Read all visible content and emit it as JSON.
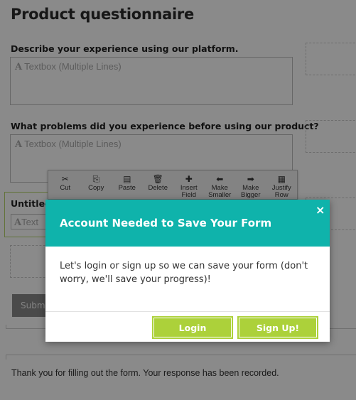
{
  "form": {
    "title": "Product questionnaire",
    "questions": [
      {
        "label": "Describe your experience using our platform.",
        "placeholder": "Textbox (Multiple Lines)"
      },
      {
        "label": "What problems did you experience before using our product?",
        "placeholder": "Textbox (Multiple Lines)"
      }
    ],
    "untitled_field": {
      "label": "Untitled",
      "placeholder": "Text"
    },
    "submit_label": "Submit",
    "thank_you": "Thank you for filling out the form. Your response has been recorded."
  },
  "toolbar": {
    "items": [
      {
        "icon": "scissors-icon",
        "glyph": "✂",
        "label1": "Cut",
        "label2": ""
      },
      {
        "icon": "copy-icon",
        "glyph": "⎘",
        "label1": "Copy",
        "label2": ""
      },
      {
        "icon": "paste-icon",
        "glyph": "▤",
        "label1": "Paste",
        "label2": ""
      },
      {
        "icon": "trash-icon",
        "glyph": "🗑",
        "label1": "Delete",
        "label2": ""
      },
      {
        "icon": "plus-icon",
        "glyph": "✚",
        "label1": "Insert",
        "label2": "Field"
      },
      {
        "icon": "arrow-left-icon",
        "glyph": "⬅",
        "label1": "Make",
        "label2": "Smaller"
      },
      {
        "icon": "arrow-right-icon",
        "glyph": "➡",
        "label1": "Make",
        "label2": "Bigger"
      },
      {
        "icon": "grid-icon",
        "glyph": "▦",
        "label1": "Justify",
        "label2": "Row"
      }
    ]
  },
  "modal": {
    "title": "Account Needed to Save Your Form",
    "close_glyph": "×",
    "body": "Let's login or sign up so we can save your form (don't worry, we'll save your progress)!",
    "login_label": "Login",
    "signup_label": "Sign Up!"
  },
  "colors": {
    "accent_teal": "#0fb3ab",
    "button_green": "#acd13a",
    "overlay": "rgba(0,0,0,0.46)"
  }
}
